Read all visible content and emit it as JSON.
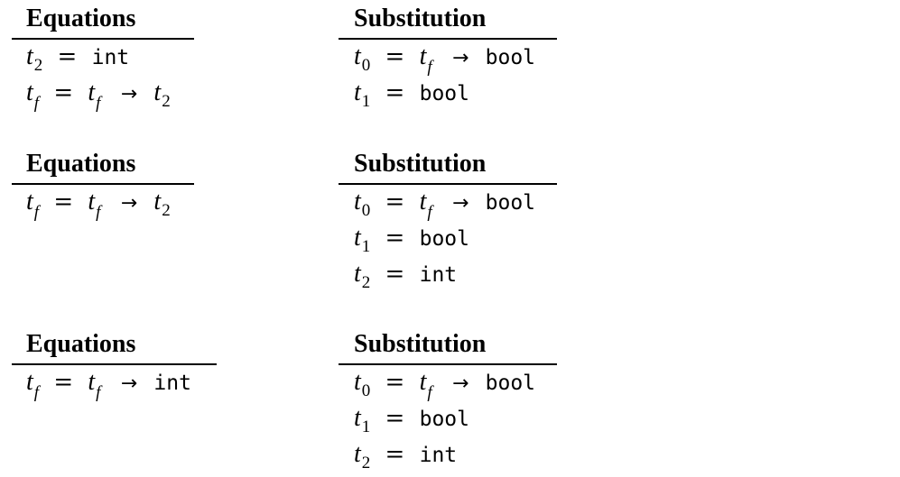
{
  "blocks": [
    {
      "equations_header": "Equations",
      "substitution_header": "Substitution",
      "equations": [
        {
          "lhs": "t",
          "lhs_sub": "2",
          "rhs_text": "int"
        },
        {
          "lhs": "t",
          "lhs_sub": "f",
          "rhs_var": "t",
          "rhs_sub": "f",
          "arrow": "→",
          "rhs_var2": "t",
          "rhs_sub2": "2"
        }
      ],
      "substitution": [
        {
          "lhs": "t",
          "lhs_sub": "0",
          "rhs_var": "t",
          "rhs_sub": "f",
          "arrow": "→",
          "rhs_text": "bool"
        },
        {
          "lhs": "t",
          "lhs_sub": "1",
          "rhs_text": "bool"
        }
      ]
    },
    {
      "equations_header": "Equations",
      "substitution_header": "Substitution",
      "equations": [
        {
          "lhs": "t",
          "lhs_sub": "f",
          "rhs_var": "t",
          "rhs_sub": "f",
          "arrow": "→",
          "rhs_var2": "t",
          "rhs_sub2": "2"
        }
      ],
      "substitution": [
        {
          "lhs": "t",
          "lhs_sub": "0",
          "rhs_var": "t",
          "rhs_sub": "f",
          "arrow": "→",
          "rhs_text": "bool"
        },
        {
          "lhs": "t",
          "lhs_sub": "1",
          "rhs_text": "bool"
        },
        {
          "lhs": "t",
          "lhs_sub": "2",
          "rhs_text": "int"
        }
      ]
    },
    {
      "equations_header": "Equations",
      "substitution_header": "Substitution",
      "equations": [
        {
          "lhs": "t",
          "lhs_sub": "f",
          "rhs_var": "t",
          "rhs_sub": "f",
          "arrow": "→",
          "rhs_text": "int"
        }
      ],
      "substitution": [
        {
          "lhs": "t",
          "lhs_sub": "0",
          "rhs_var": "t",
          "rhs_sub": "f",
          "arrow": "→",
          "rhs_text": "bool"
        },
        {
          "lhs": "t",
          "lhs_sub": "1",
          "rhs_text": "bool"
        },
        {
          "lhs": "t",
          "lhs_sub": "2",
          "rhs_text": "int"
        }
      ]
    }
  ],
  "equals_sign": "="
}
